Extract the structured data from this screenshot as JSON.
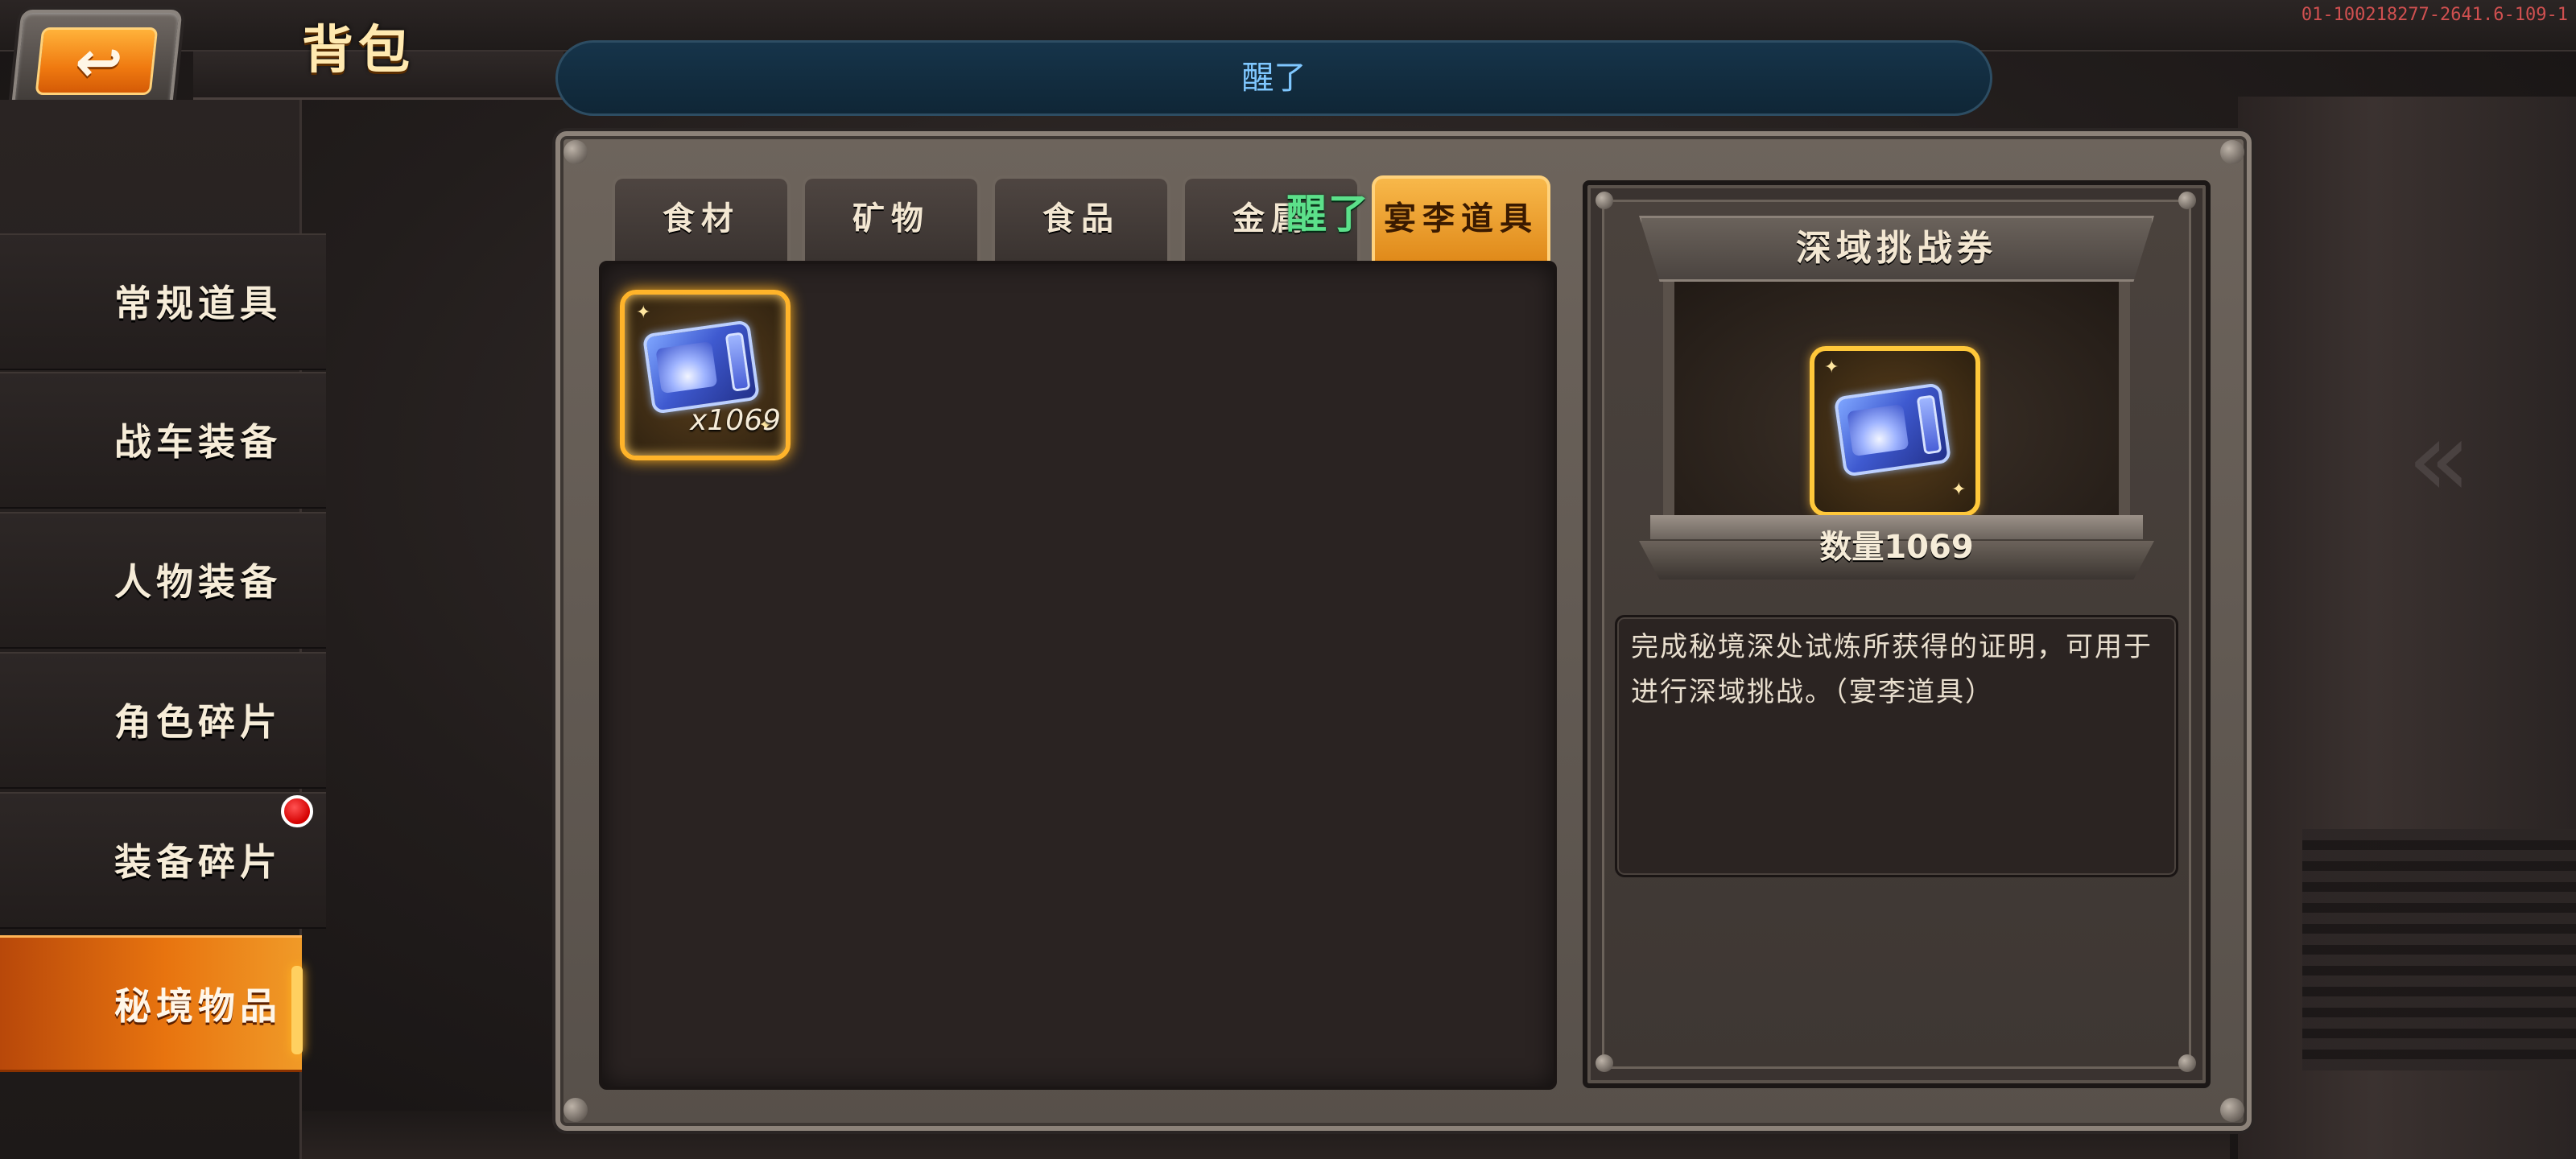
{
  "header": {
    "title": "背包",
    "notice": "醒了",
    "build_id": "01-100218277-2641.6-109-1"
  },
  "sidebar": {
    "items": [
      {
        "label": "常规道具",
        "active": false,
        "badge": false
      },
      {
        "label": "战车装备",
        "active": false,
        "badge": false
      },
      {
        "label": "人物装备",
        "active": false,
        "badge": false
      },
      {
        "label": "角色碎片",
        "active": false,
        "badge": false
      },
      {
        "label": "装备碎片",
        "active": false,
        "badge": true
      },
      {
        "label": "秘境物品",
        "active": true,
        "badge": false
      }
    ]
  },
  "tabs": [
    {
      "label": "食材",
      "active": false
    },
    {
      "label": "矿物",
      "active": false
    },
    {
      "label": "食品",
      "active": false
    },
    {
      "label": "金属",
      "active": false
    },
    {
      "label": "宴李道具",
      "active": true
    }
  ],
  "inventory": {
    "items": [
      {
        "name": "ticket-item",
        "count": "x1069"
      }
    ]
  },
  "detail": {
    "title": "深域挑战券",
    "quantity": "数量1069",
    "description": "完成秘境深处试炼所获得的证明，可用于进行深域挑战。（宴李道具）"
  },
  "overlay": {
    "text": "醒了"
  },
  "colors": {
    "accent": "#f08a1a",
    "badge": "#e00000",
    "notice_text": "#7fc7ff",
    "overlay_text": "#5ce08a"
  }
}
